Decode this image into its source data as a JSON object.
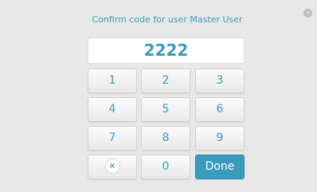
{
  "dialog": {
    "title": "Confirm code for user Master User",
    "close_icon": "close-icon"
  },
  "code_display": {
    "value": "2222"
  },
  "keypad": {
    "keys": [
      "1",
      "2",
      "3",
      "4",
      "5",
      "6",
      "7",
      "8",
      "9"
    ],
    "clear_icon": "clear-icon",
    "clear_glyph": "×",
    "zero": "0",
    "done": "Done"
  },
  "colors": {
    "accent": "#3a9bbd",
    "background": "#e8e8e8"
  }
}
